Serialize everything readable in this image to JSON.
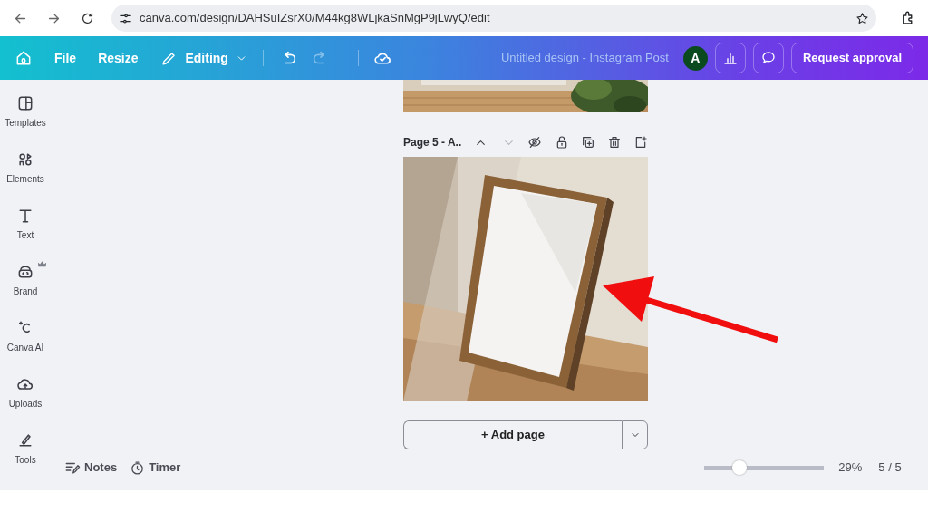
{
  "browser": {
    "url": "canva.com/design/DAHSuIZsrX0/M44kg8WLjkaSnMgP9jLwyQ/edit"
  },
  "toolbar": {
    "file": "File",
    "resize": "Resize",
    "mode": "Editing",
    "history": [
      {
        "kind": "undo",
        "disabled": false
      },
      {
        "kind": "redo",
        "disabled": true
      }
    ],
    "title": "Untitled design - Instagram Post",
    "avatar": "A",
    "request": "Request approval"
  },
  "sidebar": {
    "items": [
      {
        "kind": "templates",
        "label": "Templates",
        "premium": false
      },
      {
        "kind": "elements",
        "label": "Elements",
        "premium": false
      },
      {
        "kind": "text",
        "label": "Text",
        "premium": false
      },
      {
        "kind": "brand",
        "label": "Brand",
        "premium": true
      },
      {
        "kind": "ai",
        "label": "Canva AI",
        "premium": false
      },
      {
        "kind": "uploads",
        "label": "Uploads",
        "premium": false
      },
      {
        "kind": "tools",
        "label": "Tools",
        "premium": false
      }
    ]
  },
  "page": {
    "title": "Page 5 - A..",
    "moves": [
      {
        "kind": "up",
        "disabled": false
      },
      {
        "kind": "down",
        "disabled": true
      }
    ],
    "add": "+ Add page"
  },
  "footer": {
    "notes": "Notes",
    "timer": "Timer",
    "zoom": {
      "level": 0.29,
      "reading": "29%"
    },
    "pages": "5 / 5"
  }
}
